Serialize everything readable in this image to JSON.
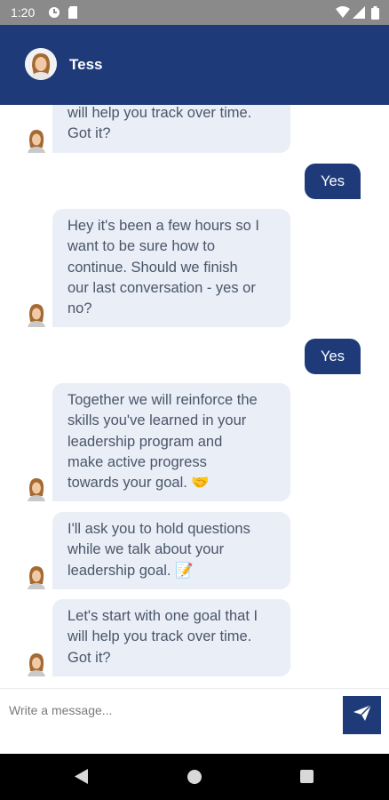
{
  "status_bar": {
    "time": "1:20",
    "icons_left": [
      "data-saver-icon",
      "sd-card-icon"
    ],
    "icons_right": [
      "wifi-icon",
      "signal-icon",
      "battery-icon"
    ]
  },
  "header": {
    "bot_name": "Tess",
    "color": "#1e3a78"
  },
  "messages": [
    {
      "from": "bot",
      "text": "will help you track over time.\nGot it?"
    },
    {
      "from": "user",
      "text": "Yes"
    },
    {
      "from": "bot",
      "text": "Hey it's been a few hours so I\nwant to be sure how to\ncontinue. Should we finish\nour last conversation - yes or\nno?"
    },
    {
      "from": "user",
      "text": "Yes"
    },
    {
      "from": "bot",
      "text": "Together we will reinforce the\nskills you've learned in your\nleadership program and\nmake active progress\ntowards your goal. 🤝"
    },
    {
      "from": "bot",
      "text": "I'll ask you to hold questions\nwhile we talk about your\nleadership goal. 📝"
    },
    {
      "from": "bot",
      "text": "Let's start with one goal that I\nwill help you track over time.\nGot it?"
    }
  ],
  "composer": {
    "placeholder": "Write a message...",
    "send_icon": "send-icon"
  },
  "colors": {
    "accent": "#1e3a78",
    "bot_bubble": "#e9eef7",
    "bot_text": "#4a5668"
  }
}
